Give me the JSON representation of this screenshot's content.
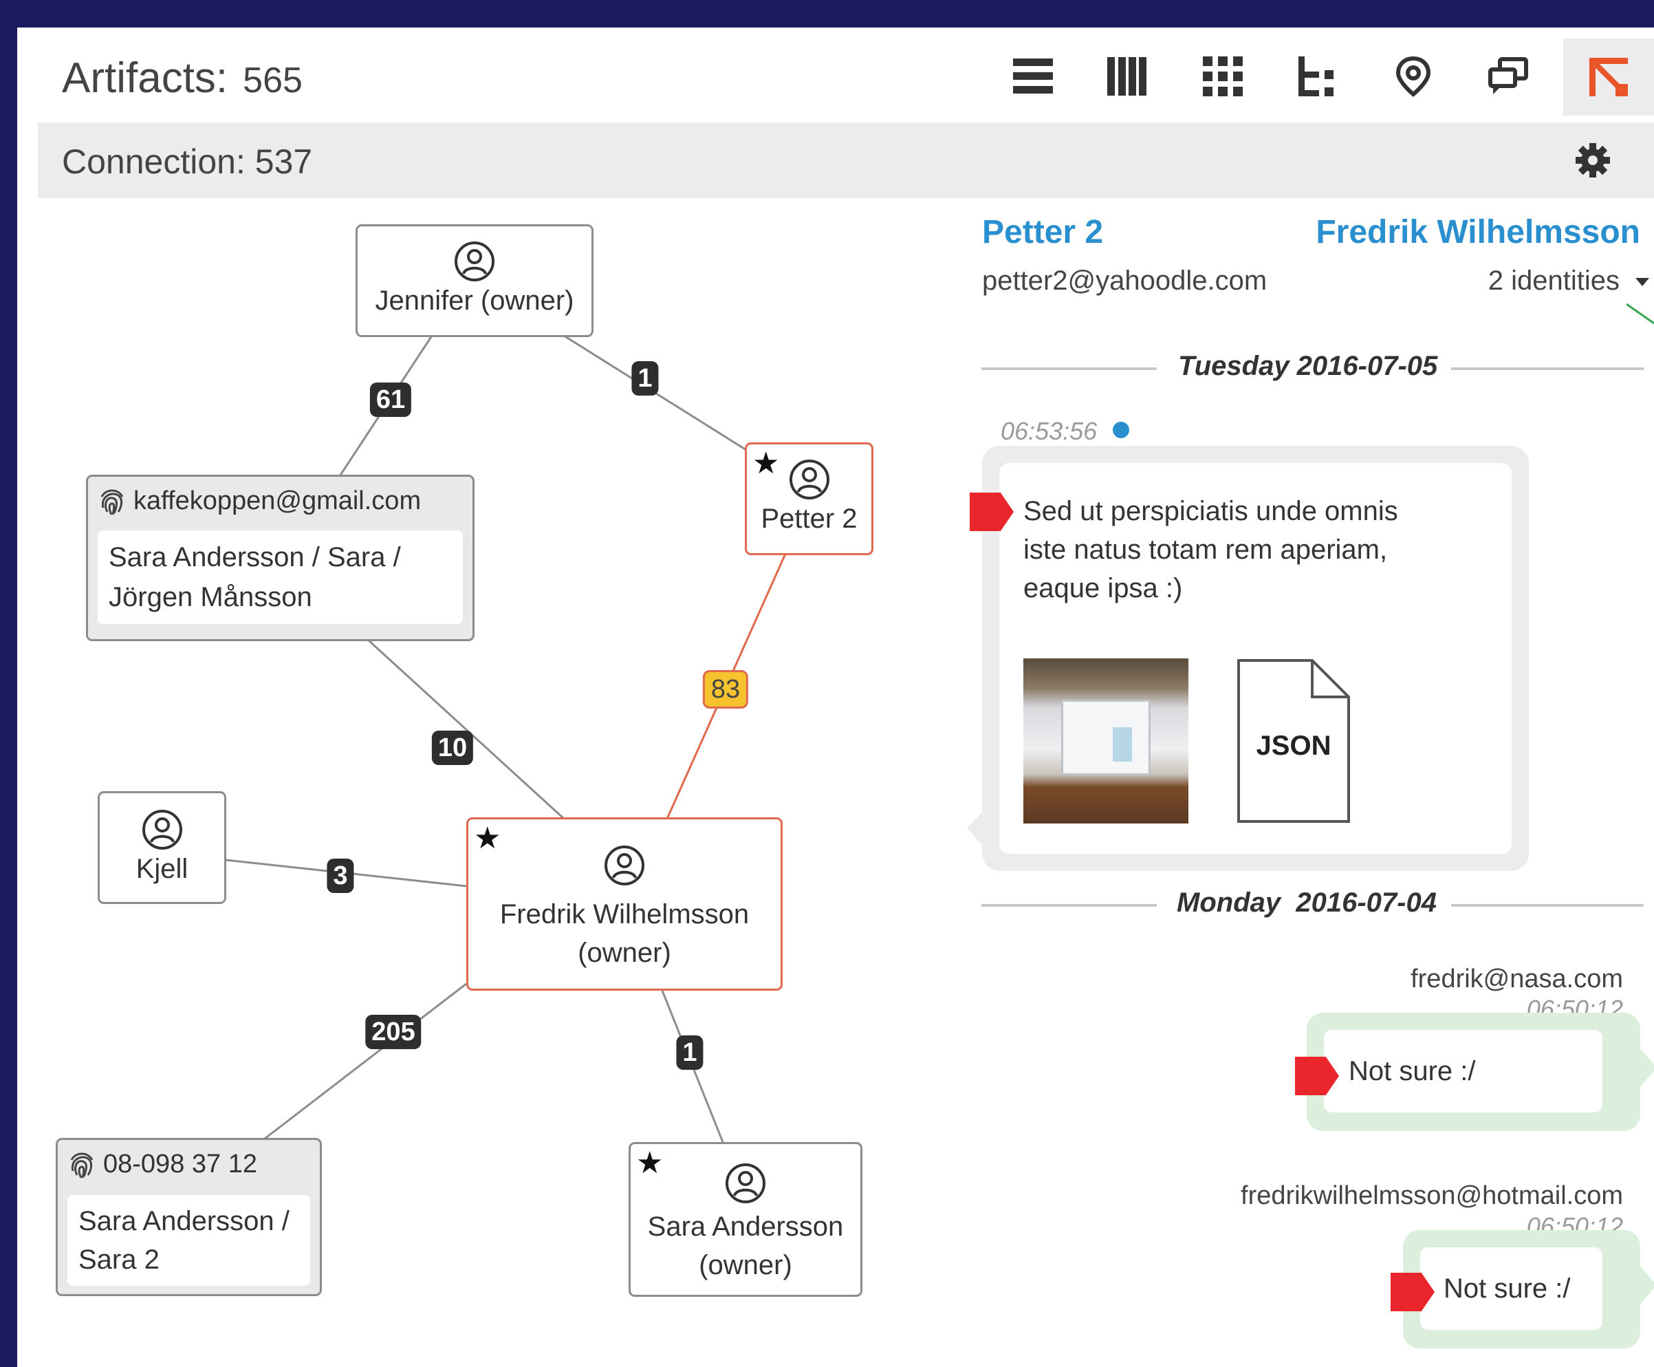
{
  "header": {
    "artifacts_label": "Artifacts:",
    "artifacts_count": "565"
  },
  "connection": {
    "label": "Connection:",
    "count": "537"
  },
  "toolbar": {
    "views": [
      "list-view-icon",
      "column-view-icon",
      "grid-view-icon",
      "tree-view-icon",
      "map-view-icon",
      "conversation-view-icon",
      "graph-view-icon"
    ],
    "active": "graph-view-icon"
  },
  "graph": {
    "nodes": {
      "jennifer": {
        "label": "Jennifer (owner)"
      },
      "petter": {
        "label": "Petter 2"
      },
      "kjell": {
        "label": "Kjell"
      },
      "fredrik": {
        "line1": "Fredrik Wilhelmsson",
        "line2": "(owner)"
      },
      "sara": {
        "line1": "Sara Andersson",
        "line2": "(owner)"
      }
    },
    "identities": {
      "email": {
        "id": "kaffekoppen@gmail.com",
        "names_line1": "Sara Andersson / Sara /",
        "names_line2": "Jörgen Månsson"
      },
      "phone": {
        "id": "08-098 37 12",
        "names_line1": "Sara Andersson /",
        "names_line2": "Sara 2"
      }
    },
    "edge_counts": {
      "jennifer_email": "61",
      "jennifer_petter": "1",
      "petter_fredrik": "83",
      "email_fredrik": "10",
      "kjell_fredrik": "3",
      "fredrik_phone": "205",
      "fredrik_sara": "1"
    }
  },
  "chat": {
    "left_name": "Petter 2",
    "left_email": "petter2@yahoodle.com",
    "right_name": "Fredrik Wilhelmsson",
    "right_identities": "2 identities",
    "day1": "Tuesday 2016-07-05",
    "msg1": {
      "time": "06:53:56",
      "line1": "Sed ut perspiciatis unde omnis",
      "line2": "iste natus totam rem aperiam,",
      "line3": "eaque ipsa :)",
      "file_label": "JSON"
    },
    "day2": "Monday  2016-07-04",
    "msg2": {
      "sender": "fredrik@nasa.com",
      "time": "06:50:12",
      "text": "Not sure :/"
    },
    "msg3": {
      "sender": "fredrikwilhelmsson@hotmail.com",
      "time": "06:50:12",
      "text": "Not sure :/"
    }
  },
  "colors": {
    "background": "#1b1b5e",
    "accent_blue": "#2a8fce",
    "highlight_red": "#e0694e",
    "flag_red": "#e8262b",
    "badge_dark": "#2e2e2e",
    "badge_yellow": "#f6c22e",
    "bubble_green": "#dcefdc"
  }
}
